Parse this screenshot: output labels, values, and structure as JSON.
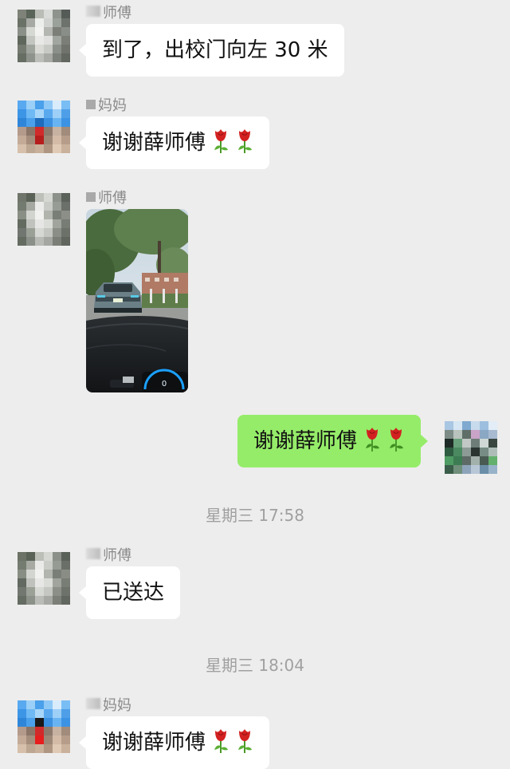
{
  "messages": [
    {
      "sender": "师傅",
      "text": "到了，出校门向左 30 米"
    },
    {
      "sender": "妈妈",
      "text": "谢谢薛师傅"
    },
    {
      "sender": "师傅",
      "type": "image"
    },
    {
      "text": "谢谢薛师傅"
    },
    {
      "sender": "师傅",
      "text": "已送达"
    },
    {
      "sender": "妈妈",
      "text": "谢谢薛师傅"
    }
  ],
  "timestamps": [
    "星期三 17:58",
    "星期三 18:04"
  ],
  "colors": {
    "background": "#ededed",
    "incoming_bubble": "#ffffff",
    "outgoing_bubble": "#95ec69",
    "rose": "#d32121"
  }
}
